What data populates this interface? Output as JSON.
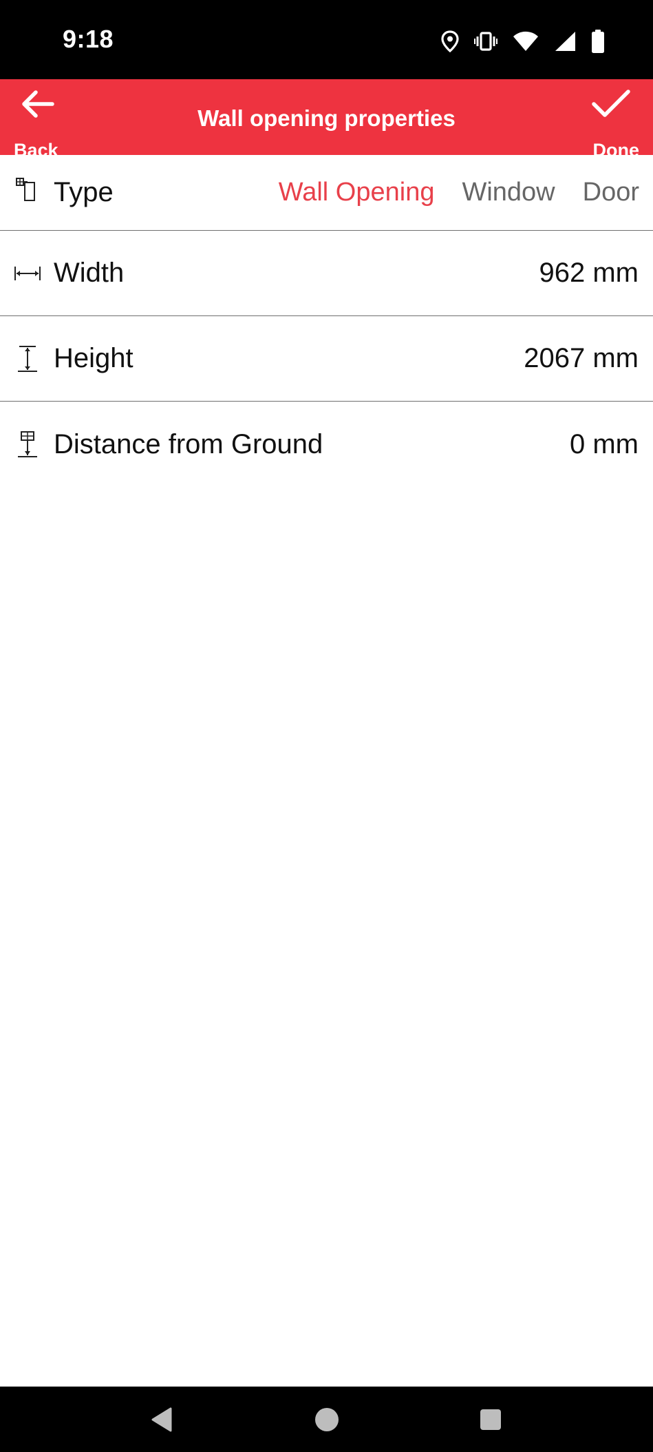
{
  "status_bar": {
    "time": "9:18",
    "icons": [
      "location-icon",
      "vibrate-icon",
      "wifi-icon",
      "signal-icon",
      "battery-icon"
    ]
  },
  "app_bar": {
    "title": "Wall opening properties",
    "back_label": "Back",
    "done_label": "Done",
    "background": "#ee3340"
  },
  "properties": {
    "type": {
      "label": "Type",
      "icon": "wall-opening-type-icon",
      "options": [
        "Wall Opening",
        "Window",
        "Door"
      ],
      "selected": "Wall Opening"
    },
    "width": {
      "label": "Width",
      "value": "962 mm",
      "icon": "width-dimension-icon"
    },
    "height": {
      "label": "Height",
      "value": "2067 mm",
      "icon": "height-dimension-icon"
    },
    "distance": {
      "label": "Distance from Ground",
      "value": "0 mm",
      "icon": "ground-distance-icon"
    }
  },
  "accent_color": "#e8404a",
  "nav_bar": {
    "buttons": [
      "back-nav-icon",
      "home-nav-icon",
      "recents-nav-icon"
    ]
  }
}
